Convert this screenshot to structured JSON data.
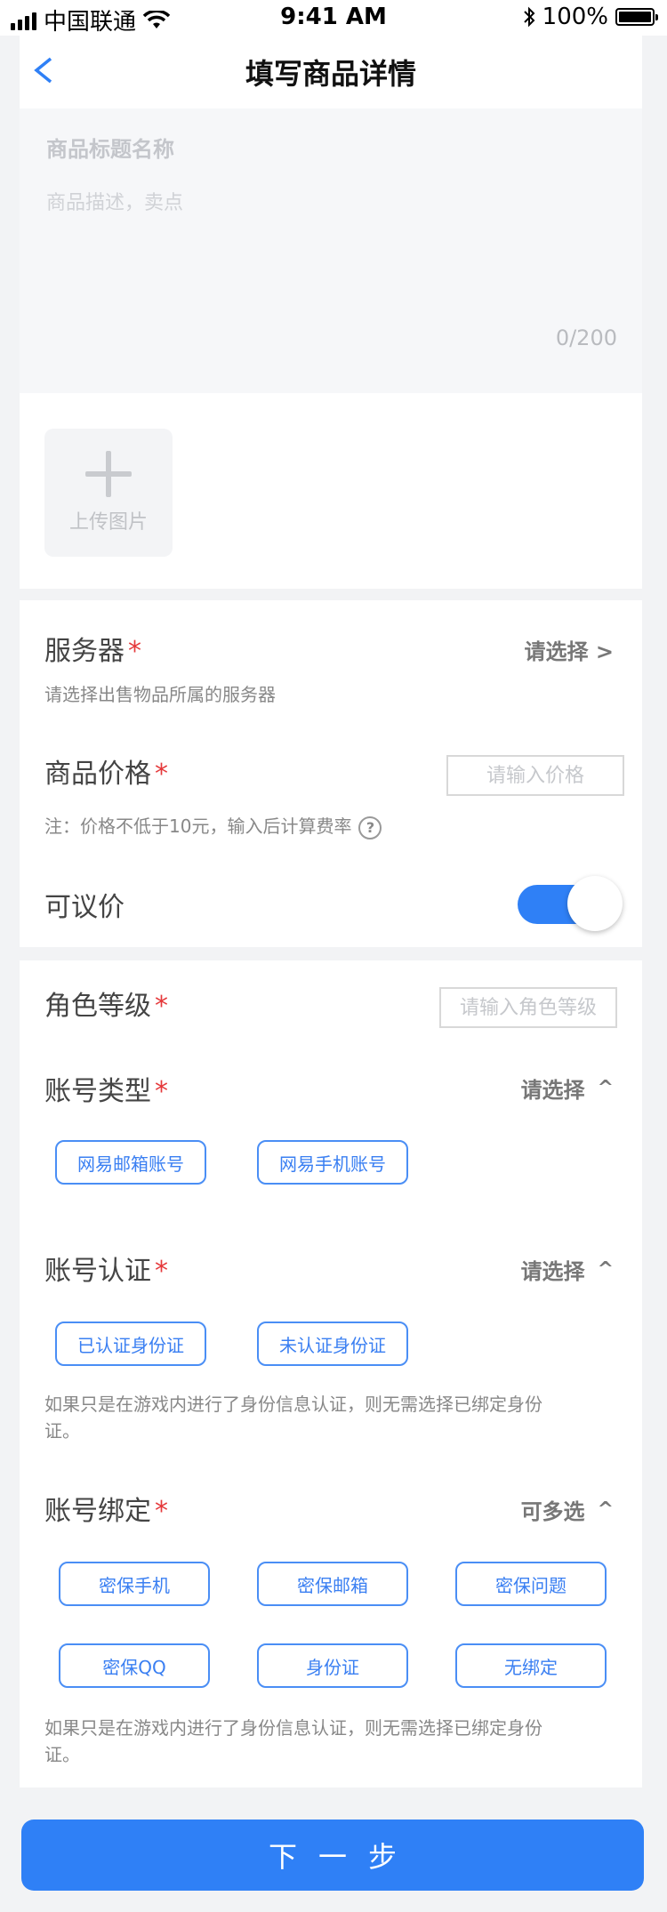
{
  "status_bar": {
    "carrier": "中国联通",
    "time": "9:41 AM",
    "battery": "100%",
    "battery_level": 1.0
  },
  "nav": {
    "title": "填写商品详情",
    "back_icon": "chevron-left-icon"
  },
  "description": {
    "title_placeholder": "商品标题名称",
    "desc_placeholder": "商品描述，卖点",
    "char_count": "0/200"
  },
  "upload": {
    "label": "上传图片",
    "icon": "plus-icon"
  },
  "server": {
    "label": "服务器",
    "action": "请选择 >",
    "hint": "请选择出售物品所属的服务器"
  },
  "price": {
    "label": "商品价格",
    "placeholder": "请输入价格",
    "hint": "注：价格不低于10元，输入后计算费率",
    "help": "?"
  },
  "negotiable": {
    "label": "可议价",
    "on": true
  },
  "role_level": {
    "label": "角色等级",
    "placeholder": "请输入角色等级"
  },
  "account_type": {
    "label": "账号类型",
    "action": "请选择",
    "chevron": "^",
    "options": [
      "网易邮箱账号",
      "网易手机账号"
    ]
  },
  "account_auth": {
    "label": "账号认证",
    "action": "请选择",
    "chevron": "^",
    "options": [
      "已认证身份证",
      "未认证身份证"
    ],
    "hint_line1": "如果只是在游戏内进行了身份信息认证，则无需选择已绑定身份",
    "hint_line2": "证。"
  },
  "account_bind": {
    "label": "账号绑定",
    "action": "可多选",
    "chevron": "^",
    "options": [
      "密保手机",
      "密保邮箱",
      "密保问题",
      "密保QQ",
      "身份证",
      "无绑定"
    ],
    "hint_line1": "如果只是在游戏内进行了身份信息认证，则无需选择已绑定身份",
    "hint_line2": "证。"
  },
  "required_mark": "*",
  "next_button": "下一步",
  "colors": {
    "accent": "#2f80f6",
    "required": "#e5393b",
    "background": "#f2f3f5"
  }
}
